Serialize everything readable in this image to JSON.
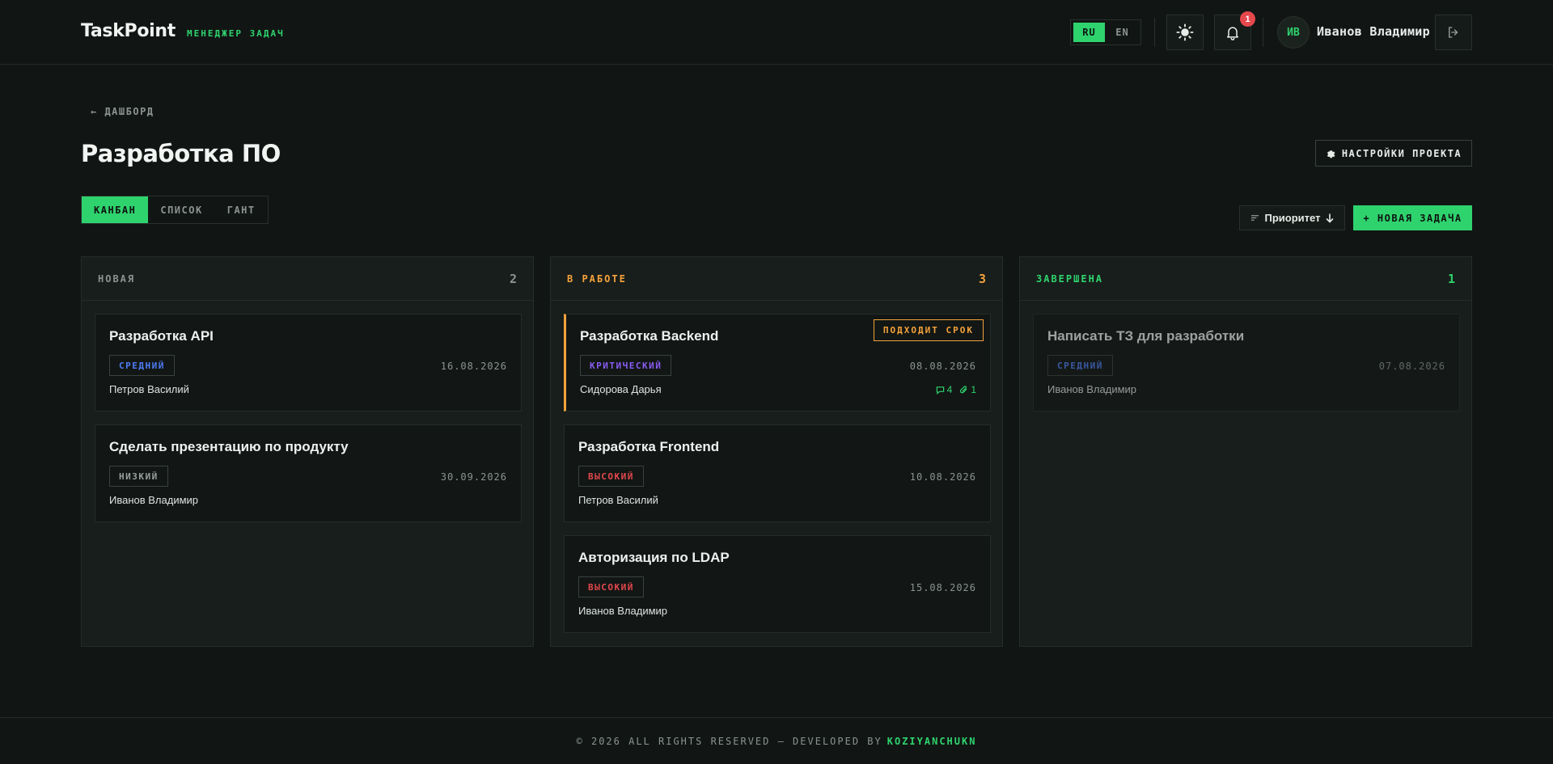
{
  "header": {
    "brand": "TaskPoint",
    "subtitle": "МЕНЕДЖЕР ЗАДАЧ",
    "languages": [
      "RU",
      "EN"
    ],
    "active_language": "RU",
    "notifications_count": "1",
    "user_initials": "ИВ",
    "user_name": "Иванов Владимир"
  },
  "page": {
    "back_label": "← ДАШБОРД",
    "title": "Разработка ПО",
    "settings_label": "НАСТРОЙКИ ПРОЕКТА"
  },
  "views": {
    "tabs": [
      "КАНБАН",
      "СПИСОК",
      "ГАНТ"
    ],
    "active": "КАНБАН"
  },
  "toolbar": {
    "sort_label": "Приоритет",
    "new_task_label": "+ НОВАЯ ЗАДАЧА"
  },
  "columns": [
    {
      "title": "НОВАЯ",
      "count": "2",
      "color": "#8c938f",
      "cards": [
        {
          "title": "Разработка API",
          "priority": "СРЕДНИЙ",
          "priority_color": "#4f7cf7",
          "date": "16.08.2026",
          "assignee": "Петров Василий"
        },
        {
          "title": "Сделать презентацию по продукту",
          "priority": "НИЗКИЙ",
          "priority_color": "#9aa19d",
          "date": "30.09.2026",
          "assignee": "Иванов Владимир"
        }
      ]
    },
    {
      "title": "В РАБОТЕ",
      "count": "3",
      "color": "#f4a23c",
      "cards": [
        {
          "title": "Разработка Backend",
          "priority": "КРИТИЧЕСКИЙ",
          "priority_color": "#8b5cf6",
          "date": "08.08.2026",
          "assignee": "Сидорова Дарья",
          "deadline_label": "ПОДХОДИТ СРОК",
          "comments": "4",
          "attachments": "1"
        },
        {
          "title": "Разработка Frontend",
          "priority": "ВЫСОКИЙ",
          "priority_color": "#e5484d",
          "date": "10.08.2026",
          "assignee": "Петров Василий"
        },
        {
          "title": "Авторизация по LDAP",
          "priority": "ВЫСОКИЙ",
          "priority_color": "#e5484d",
          "date": "15.08.2026",
          "assignee": "Иванов Владимир"
        }
      ]
    },
    {
      "title": "ЗАВЕРШЕНА",
      "count": "1",
      "color": "#2fd36e",
      "cards": [
        {
          "title": "Написать ТЗ для разработки",
          "priority": "СРЕДНИЙ",
          "priority_color": "#4f7cf7",
          "date": "07.08.2026",
          "assignee": "Иванов Владимир"
        }
      ]
    }
  ],
  "footer": {
    "text": "© 2026 ALL RIGHTS RESERVED — DEVELOPED BY",
    "developer": "KOZIYANCHUKN"
  },
  "colors": {
    "accent": "#2fd36e",
    "warning": "#f4a23c",
    "danger": "#e5484d",
    "background": "#111614"
  }
}
